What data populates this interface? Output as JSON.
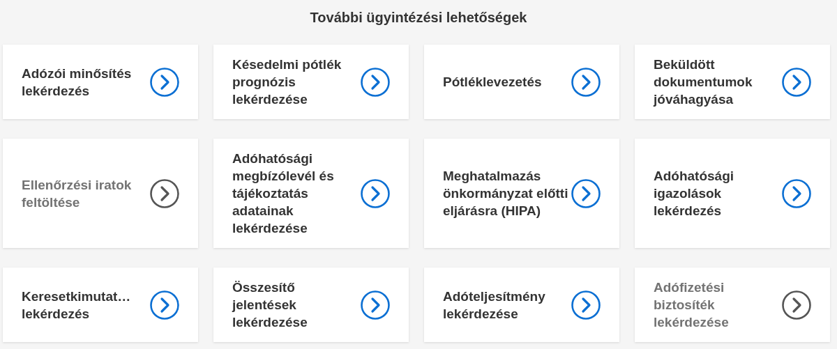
{
  "title": "További ügyintézési lehetőségek",
  "cards": [
    {
      "label": "Adózói minősítés lekérdezés",
      "disabled": false
    },
    {
      "label": "Késedelmi pótlék prognózis lekérdezése",
      "disabled": false
    },
    {
      "label": "Pótléklevezetés",
      "disabled": false
    },
    {
      "label": "Beküldött dokumentumok jóváhagyása",
      "disabled": false
    },
    {
      "label": "Ellenőrzési iratok feltöltése",
      "disabled": true
    },
    {
      "label": "Adóhatósági megbízólevél és tájékoztatás adatainak lekérdezése",
      "disabled": false
    },
    {
      "label": "Meghatalmazás önkormányzat előtti eljárásra (HIPA)",
      "disabled": false
    },
    {
      "label": "Adóhatósági igazolások lekérdezés",
      "disabled": false
    },
    {
      "label": "Keresetkimutat… lekérdezés",
      "disabled": false
    },
    {
      "label": "Összesítő jelentések lekérdezése",
      "disabled": false
    },
    {
      "label": "Adóteljesítmény lekérdezése",
      "disabled": false
    },
    {
      "label": "Adófizetési biztosíték lekérdezése",
      "disabled": true
    }
  ]
}
